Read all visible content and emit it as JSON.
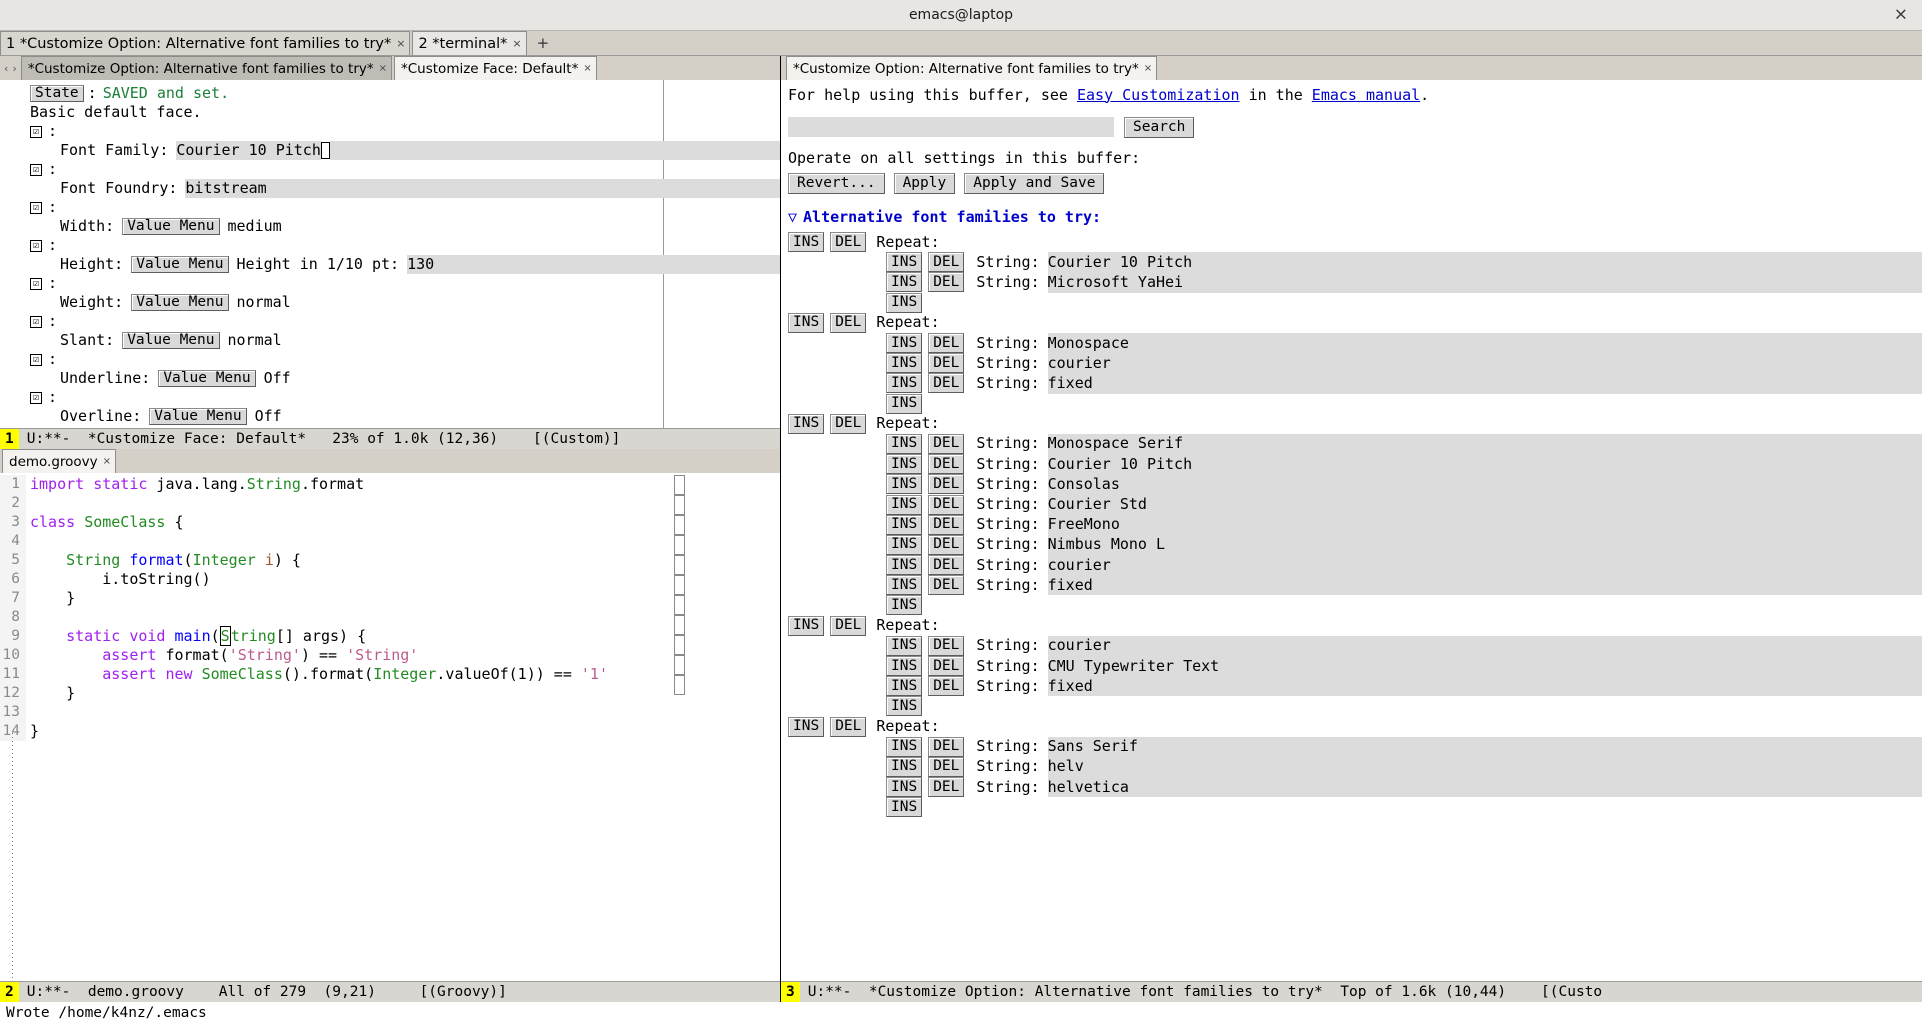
{
  "window": {
    "title": "emacs@laptop",
    "close_label": "×"
  },
  "frame_tabs": {
    "items": [
      {
        "label": "1 *Customize Option: Alternative font families to try*",
        "close": "×",
        "active": false
      },
      {
        "label": "2 *terminal*",
        "close": "×",
        "active": true
      }
    ],
    "add_label": "+"
  },
  "left_pane": {
    "tabline": {
      "prev": "‹",
      "next": "›",
      "tabs": [
        {
          "label": "*Customize Option: Alternative font families to try*",
          "close": "×",
          "selected": false
        },
        {
          "label": "*Customize Face: Default*",
          "close": "×",
          "selected": true
        }
      ]
    },
    "state_button": "State",
    "state_sep": ":",
    "state_value": "SAVED and set.",
    "description": "Basic default face.",
    "checkbox_glyph": "☑",
    "colon": ":",
    "attributes": [
      {
        "name": "Font Family:",
        "kind": "text",
        "value": "Courier 10 Pitch",
        "cursor": true
      },
      {
        "name": "Font Foundry:",
        "kind": "text",
        "value": "bitstream",
        "cursor": false
      },
      {
        "name": "Width:",
        "kind": "menu",
        "menu_label": "Value Menu",
        "value": "medium"
      },
      {
        "name": "Height:",
        "kind": "menu",
        "menu_label": "Value Menu",
        "value": "Height in 1/10 pt:",
        "field_value": "130"
      },
      {
        "name": "Weight:",
        "kind": "menu",
        "menu_label": "Value Menu",
        "value": "normal"
      },
      {
        "name": "Slant:",
        "kind": "menu",
        "menu_label": "Value Menu",
        "value": "normal"
      },
      {
        "name": "Underline:",
        "kind": "menu",
        "menu_label": "Value Menu",
        "value": "Off"
      },
      {
        "name": "Overline:",
        "kind": "menu",
        "menu_label": "Value Menu",
        "value": "Off"
      }
    ],
    "modeline": {
      "window_number": "1",
      "text": "U:**-  *Customize Face: Default*   23% of 1.0k (12,36)    [(Custom)]"
    }
  },
  "code_pane": {
    "tabline": {
      "tabs": [
        {
          "label": "demo.groovy",
          "close": "×",
          "selected": true
        }
      ]
    },
    "lines": [
      {
        "n": "1",
        "tokens": [
          {
            "t": "import",
            "c": "kw"
          },
          {
            "t": " ",
            "c": "pl"
          },
          {
            "t": "static",
            "c": "kw"
          },
          {
            "t": " java.lang.",
            "c": "pl"
          },
          {
            "t": "String",
            "c": "typ"
          },
          {
            "t": ".format",
            "c": "pl"
          }
        ]
      },
      {
        "n": "2",
        "tokens": []
      },
      {
        "n": "3",
        "tokens": [
          {
            "t": "class",
            "c": "kw"
          },
          {
            "t": " ",
            "c": "pl"
          },
          {
            "t": "SomeClass",
            "c": "typ"
          },
          {
            "t": " {",
            "c": "pl"
          }
        ]
      },
      {
        "n": "4",
        "tokens": []
      },
      {
        "n": "5",
        "tokens": [
          {
            "t": "    ",
            "c": "pl"
          },
          {
            "t": "String",
            "c": "typ"
          },
          {
            "t": " ",
            "c": "pl"
          },
          {
            "t": "format",
            "c": "fn"
          },
          {
            "t": "(",
            "c": "pl"
          },
          {
            "t": "Integer",
            "c": "typ"
          },
          {
            "t": " ",
            "c": "pl"
          },
          {
            "t": "i",
            "c": "var"
          },
          {
            "t": ") {",
            "c": "pl"
          }
        ]
      },
      {
        "n": "6",
        "tokens": [
          {
            "t": "        i.toString()",
            "c": "pl"
          }
        ]
      },
      {
        "n": "7",
        "tokens": [
          {
            "t": "    }",
            "c": "pl"
          }
        ]
      },
      {
        "n": "8",
        "tokens": []
      },
      {
        "n": "9",
        "tokens": [
          {
            "t": "    ",
            "c": "pl"
          },
          {
            "t": "static",
            "c": "kw"
          },
          {
            "t": " ",
            "c": "pl"
          },
          {
            "t": "void",
            "c": "kw"
          },
          {
            "t": " ",
            "c": "pl"
          },
          {
            "t": "main",
            "c": "fn"
          },
          {
            "t": "(",
            "c": "pl"
          },
          {
            "t": "S",
            "c": "cursor"
          },
          {
            "t": "tring",
            "c": "typ"
          },
          {
            "t": "[] args) {",
            "c": "pl"
          }
        ]
      },
      {
        "n": "10",
        "tokens": [
          {
            "t": "        ",
            "c": "pl"
          },
          {
            "t": "assert",
            "c": "kw"
          },
          {
            "t": " format(",
            "c": "pl"
          },
          {
            "t": "'String'",
            "c": "str"
          },
          {
            "t": ") == ",
            "c": "pl"
          },
          {
            "t": "'String'",
            "c": "str"
          }
        ]
      },
      {
        "n": "11",
        "tokens": [
          {
            "t": "        ",
            "c": "pl"
          },
          {
            "t": "assert",
            "c": "kw"
          },
          {
            "t": " ",
            "c": "pl"
          },
          {
            "t": "new",
            "c": "kw"
          },
          {
            "t": " ",
            "c": "pl"
          },
          {
            "t": "SomeClass",
            "c": "typ"
          },
          {
            "t": "().format(",
            "c": "pl"
          },
          {
            "t": "Integer",
            "c": "typ"
          },
          {
            "t": ".valueOf(1)) == ",
            "c": "pl"
          },
          {
            "t": "'1'",
            "c": "str"
          }
        ]
      },
      {
        "n": "12",
        "tokens": [
          {
            "t": "    }",
            "c": "pl"
          }
        ]
      },
      {
        "n": "13",
        "tokens": []
      },
      {
        "n": "14",
        "tokens": [
          {
            "t": "}",
            "c": "pl"
          }
        ]
      }
    ],
    "modeline": {
      "window_number": "2",
      "text": "U:**-  demo.groovy    All of 279  (9,21)     [(Groovy)]"
    }
  },
  "right_pane": {
    "tabline": {
      "tabs": [
        {
          "label": "*Customize Option: Alternative font families to try*",
          "close": "×",
          "selected": true
        }
      ]
    },
    "help_line": {
      "prefix": "For help using this buffer, see ",
      "link1": "Easy Customization",
      "middle": " in the ",
      "link2": "Emacs manual",
      "suffix": "."
    },
    "search": {
      "input_value": "",
      "input_placeholder": "",
      "button_label": "Search"
    },
    "operate_label": "Operate on all settings in this buffer:",
    "buttons": [
      {
        "label": "Revert..."
      },
      {
        "label": "Apply"
      },
      {
        "label": "Apply and Save"
      }
    ],
    "section": {
      "arrow": "▽",
      "title": "Alternative font families to try",
      "colon": ":"
    },
    "ins_label": "INS",
    "del_label": "DEL",
    "repeat_label": "Repeat:",
    "string_label": "String:",
    "groups": [
      {
        "items": [
          "Courier 10 Pitch",
          "Microsoft YaHei"
        ]
      },
      {
        "items": [
          "Monospace",
          "courier",
          "fixed"
        ]
      },
      {
        "items": [
          "Monospace Serif",
          "Courier 10 Pitch",
          "Consolas",
          "Courier Std",
          "FreeMono",
          "Nimbus Mono L",
          "courier",
          "fixed"
        ]
      },
      {
        "items": [
          "courier",
          "CMU Typewriter Text",
          "fixed"
        ]
      },
      {
        "items": [
          "Sans Serif",
          "helv",
          "helvetica"
        ]
      }
    ],
    "modeline": {
      "window_number": "3",
      "text": "U:**-  *Customize Option: Alternative font families to try*  Top of 1.6k (10,44)    [(Custo"
    }
  },
  "echo_area": {
    "message": "Wrote /home/k4nz/.emacs"
  }
}
